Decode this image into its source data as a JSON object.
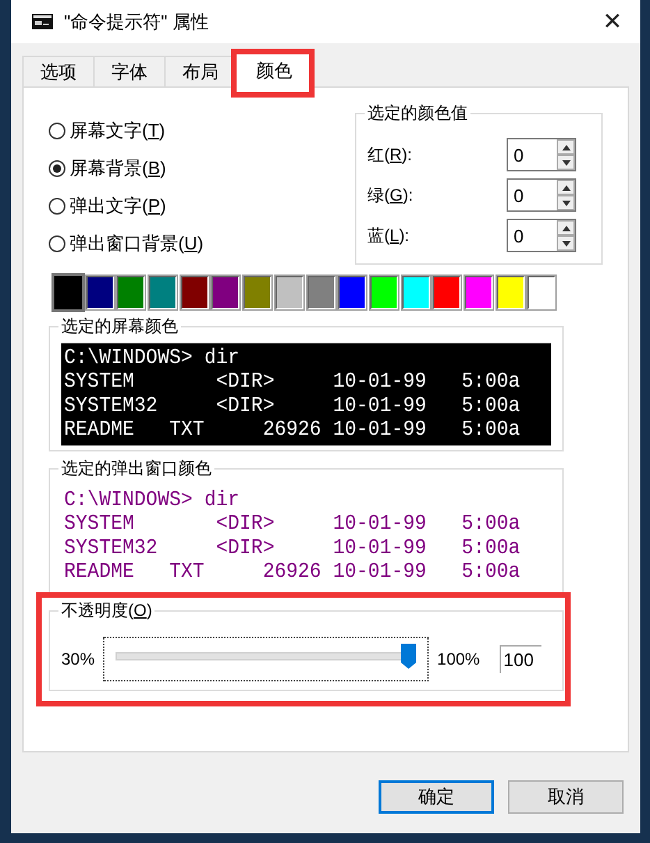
{
  "window": {
    "title": "\"命令提示符\" 属性",
    "close": "✕"
  },
  "tabs": [
    {
      "label": "选项",
      "selected": false,
      "highlighted": false
    },
    {
      "label": "字体",
      "selected": false,
      "highlighted": false
    },
    {
      "label": "布局",
      "selected": false,
      "highlighted": false
    },
    {
      "label": "颜色",
      "selected": true,
      "highlighted": true
    }
  ],
  "targets": [
    {
      "label": "屏幕文字(T)",
      "selected": false
    },
    {
      "label": "屏幕背景(B)",
      "selected": true
    },
    {
      "label": "弹出文字(P)",
      "selected": false
    },
    {
      "label": "弹出窗口背景(U)",
      "selected": false
    }
  ],
  "color_values": {
    "title": "选定的颜色值",
    "fields": [
      {
        "label": "红(R):",
        "value": "0"
      },
      {
        "label": "绿(G):",
        "value": "0"
      },
      {
        "label": "蓝(L):",
        "value": "0"
      }
    ]
  },
  "palette": [
    {
      "color": "#000000",
      "selected": true
    },
    {
      "color": "#000080",
      "selected": false
    },
    {
      "color": "#008000",
      "selected": false
    },
    {
      "color": "#008080",
      "selected": false
    },
    {
      "color": "#800000",
      "selected": false
    },
    {
      "color": "#800080",
      "selected": false
    },
    {
      "color": "#808000",
      "selected": false
    },
    {
      "color": "#c0c0c0",
      "selected": false
    },
    {
      "color": "#808080",
      "selected": false
    },
    {
      "color": "#0000ff",
      "selected": false
    },
    {
      "color": "#00ff00",
      "selected": false
    },
    {
      "color": "#00ffff",
      "selected": false
    },
    {
      "color": "#ff0000",
      "selected": false
    },
    {
      "color": "#ff00ff",
      "selected": false
    },
    {
      "color": "#ffff00",
      "selected": false
    },
    {
      "color": "#ffffff",
      "selected": false
    }
  ],
  "screen_preview": {
    "title": "选定的屏幕颜色",
    "text": {
      "color": "#ffffff"
    },
    "background": {
      "color": "#000000"
    },
    "lines": [
      "C:\\WINDOWS> dir",
      "SYSTEM       <DIR>     10-01-99   5:00a",
      "SYSTEM32     <DIR>     10-01-99   5:00a",
      "README   TXT     26926 10-01-99   5:00a"
    ]
  },
  "popup_preview": {
    "title": "选定的弹出窗口颜色",
    "text": {
      "color": "#800080"
    },
    "background": {
      "color": "#ffffff"
    },
    "lines": [
      "C:\\WINDOWS> dir",
      "SYSTEM       <DIR>     10-01-99   5:00a",
      "SYSTEM32     <DIR>     10-01-99   5:00a",
      "README   TXT     26926 10-01-99   5:00a"
    ]
  },
  "opacity": {
    "title": "不透明度(O)",
    "highlighted": true,
    "min_label": "30%",
    "max_label": "100%",
    "level": 1,
    "value": "100"
  },
  "buttons": [
    {
      "label": "确定",
      "default": true
    },
    {
      "label": "取消",
      "default": false
    }
  ]
}
